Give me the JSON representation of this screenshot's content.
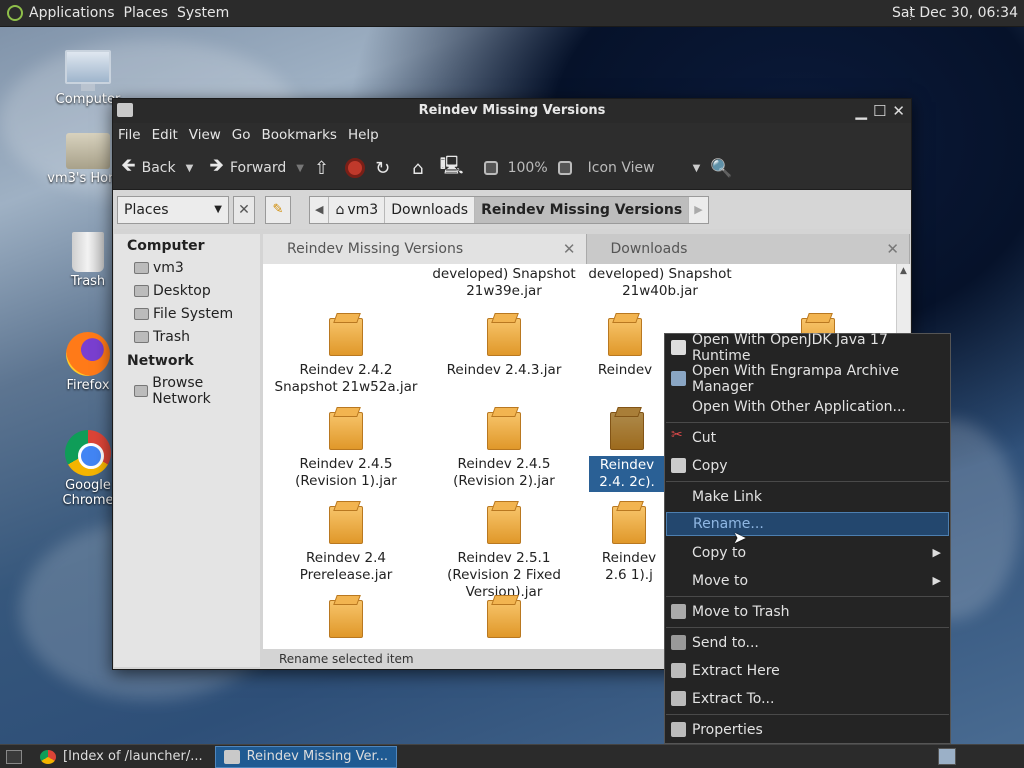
{
  "top_panel": {
    "menus": [
      "Applications",
      "Places",
      "System"
    ],
    "clock": "Sat Dec 30, 06:34"
  },
  "desktop": {
    "icons": [
      {
        "label": "Computer",
        "icon": "computer-icon"
      },
      {
        "label": "vm3's Home",
        "icon": "home-folder-icon"
      },
      {
        "label": "Trash",
        "icon": "trash-icon"
      },
      {
        "label": "Firefox",
        "icon": "firefox-icon"
      },
      {
        "label": "Google Chrome",
        "icon": "chrome-icon"
      }
    ]
  },
  "window": {
    "title": "Reindev Missing Versions",
    "menubar": [
      "File",
      "Edit",
      "View",
      "Go",
      "Bookmarks",
      "Help"
    ],
    "toolbar": {
      "back": "Back",
      "forward": "Forward",
      "zoom": "100%",
      "view_mode": "Icon View"
    },
    "location": {
      "places_label": "Places",
      "crumbs": [
        "vm3",
        "Downloads",
        "Reindev Missing Versions"
      ]
    },
    "sidebar": {
      "computer_header": "Computer",
      "computer_items": [
        "vm3",
        "Desktop",
        "File System",
        "Trash"
      ],
      "network_header": "Network",
      "network_items": [
        "Browse Network"
      ]
    },
    "tabs": [
      {
        "label": "Reindev Missing Versions",
        "active": true
      },
      {
        "label": "Downloads",
        "active": false
      }
    ],
    "files": [
      {
        "name": "developed) Snapshot 21w39e.jar",
        "partial_top": true
      },
      {
        "name": "developed) Snapshot 21w40b.jar",
        "partial_top": true
      },
      {
        "name": "Reindev 2.4.2 Snapshot 21w52a.jar"
      },
      {
        "name": "Reindev 2.4.3.jar"
      },
      {
        "name": "Reindev"
      },
      {
        "name": "Reindev 2.4.5 (Revision 1).jar"
      },
      {
        "name": "Reindev 2.4.5 (Revision 2).jar"
      },
      {
        "name": "Reindev 2.4. 2c).",
        "selected": true
      },
      {
        "name": "Reindev 2.4 Prerelease.jar"
      },
      {
        "name": "Reindev 2.5.1 (Revision 2 Fixed Version).jar"
      },
      {
        "name": "Reindev 2.6 1).j"
      }
    ],
    "status": "Rename selected item"
  },
  "context_menu": {
    "items": [
      {
        "label": "Open With OpenJDK Java 17 Runtime",
        "icon": "java-icon"
      },
      {
        "label": "Open With Engrampa Archive Manager",
        "icon": "archive-manager-icon"
      },
      {
        "label": "Open With Other Application...",
        "icon": ""
      },
      {
        "label": "Cut",
        "icon": "scissors-icon"
      },
      {
        "label": "Copy",
        "icon": "copy-icon"
      },
      {
        "label": "Make Link",
        "icon": ""
      },
      {
        "label": "Rename...",
        "icon": "",
        "highlighted": true
      },
      {
        "label": "Copy to",
        "icon": "",
        "submenu": true
      },
      {
        "label": "Move to",
        "icon": "",
        "submenu": true
      },
      {
        "label": "Move to Trash",
        "icon": "trash-icon"
      },
      {
        "label": "Send to...",
        "icon": "send-icon"
      },
      {
        "label": "Extract Here",
        "icon": "extract-icon"
      },
      {
        "label": "Extract To...",
        "icon": "extract-icon"
      },
      {
        "label": "Properties",
        "icon": "properties-icon"
      }
    ]
  },
  "taskbar": {
    "tasks": [
      {
        "label": "[Index of /launcher/...",
        "active": false
      },
      {
        "label": "Reindev Missing Ver...",
        "active": true
      }
    ]
  }
}
